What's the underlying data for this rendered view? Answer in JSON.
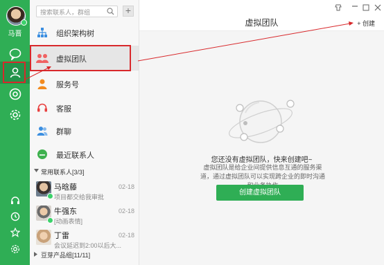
{
  "user": {
    "name": "马晋"
  },
  "search": {
    "placeholder": "搜索联系人，群组"
  },
  "add_button": {
    "label": "+"
  },
  "nav": [
    {
      "label": "组织架构树",
      "icon": "org-tree-icon"
    },
    {
      "label": "虚拟团队",
      "icon": "virtual-team-icon"
    },
    {
      "label": "服务号",
      "icon": "service-account-icon"
    },
    {
      "label": "客服",
      "icon": "customer-service-icon"
    },
    {
      "label": "群聊",
      "icon": "group-chat-icon"
    },
    {
      "label": "最近联系人",
      "icon": "recent-contacts-icon"
    }
  ],
  "frequent_group": {
    "label": "常用联系人[3/3]"
  },
  "contacts": [
    {
      "name": "马晗藤",
      "message": "项目都交给我审批",
      "date": "02-18"
    },
    {
      "name": "牛强东",
      "message": "[动画表情]",
      "date": "02-18"
    },
    {
      "name": "丁雷",
      "message": "会议延迟到2:00以后大...",
      "date": "02-18"
    }
  ],
  "bean_group": {
    "label": "豆芽产品组[11/11]"
  },
  "main": {
    "title": "虚拟团队",
    "create_link": "+ 创建",
    "empty_title": "您还没有虚拟团队，快来创建吧~",
    "empty_desc": "虚拟团队是给企业间提供信息互通的服务渠道，通过虚拟团队可以实现跨企业的即时沟通和业务协作",
    "create_button": "创建虚拟团队"
  },
  "colors": {
    "brand_green": "#2fae55",
    "highlight_red": "#d8282b"
  }
}
